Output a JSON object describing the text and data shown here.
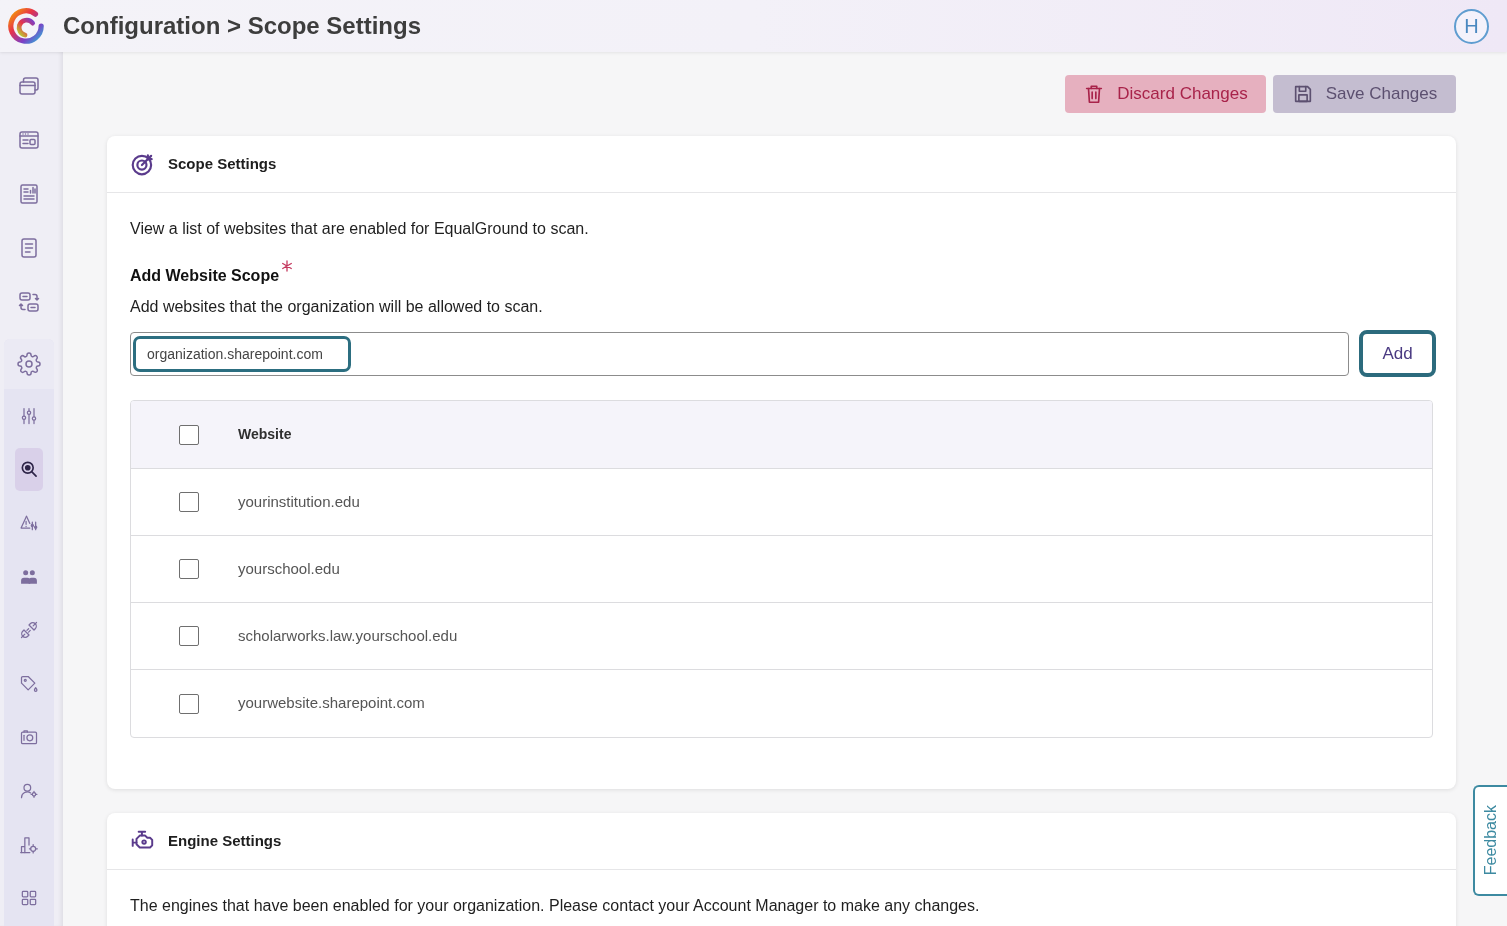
{
  "header": {
    "title": "Configuration > Scope Settings",
    "avatar_initial": "H"
  },
  "sidebar": {
    "items": [
      {
        "selected": false
      },
      {
        "selected": false
      },
      {
        "selected": false
      },
      {
        "selected": false
      },
      {
        "selected": false
      },
      {
        "selected": false,
        "expanded": true,
        "children": [
          {
            "selected": false
          },
          {
            "selected": true
          },
          {
            "selected": false
          },
          {
            "selected": false
          },
          {
            "selected": false
          },
          {
            "selected": false
          },
          {
            "selected": false
          },
          {
            "selected": false
          },
          {
            "selected": false
          },
          {
            "selected": false
          }
        ]
      }
    ]
  },
  "actions": [
    {
      "label": "Discard Changes",
      "kind": "discard"
    },
    {
      "label": "Save Changes",
      "kind": "save"
    }
  ],
  "scope_settings": {
    "title": "Scope Settings",
    "description": "View a list of websites that are enabled for EqualGround to scan.",
    "field_label": "Add Website Scope",
    "required": true,
    "field_hint": "Add websites that the organization will be allowed to scan.",
    "input": {
      "value": "organization.sharepoint.com",
      "focused": true
    },
    "add_button": {
      "label": "Add",
      "focused": true
    },
    "table": {
      "columns": [
        "Website"
      ],
      "select_all_checked": false,
      "rows": [
        {
          "website": "yourinstitution.edu",
          "checked": false
        },
        {
          "website": "yourschool.edu",
          "checked": false
        },
        {
          "website": "scholarworks.law.yourschool.edu",
          "checked": false
        },
        {
          "website": "yourwebsite.sharepoint.com",
          "checked": false
        }
      ]
    }
  },
  "engine_settings": {
    "title": "Engine Settings",
    "description": "The engines that have been enabled for your organization. Please contact your Account Manager to make any changes."
  },
  "feedback_tab": {
    "label": "Feedback"
  }
}
